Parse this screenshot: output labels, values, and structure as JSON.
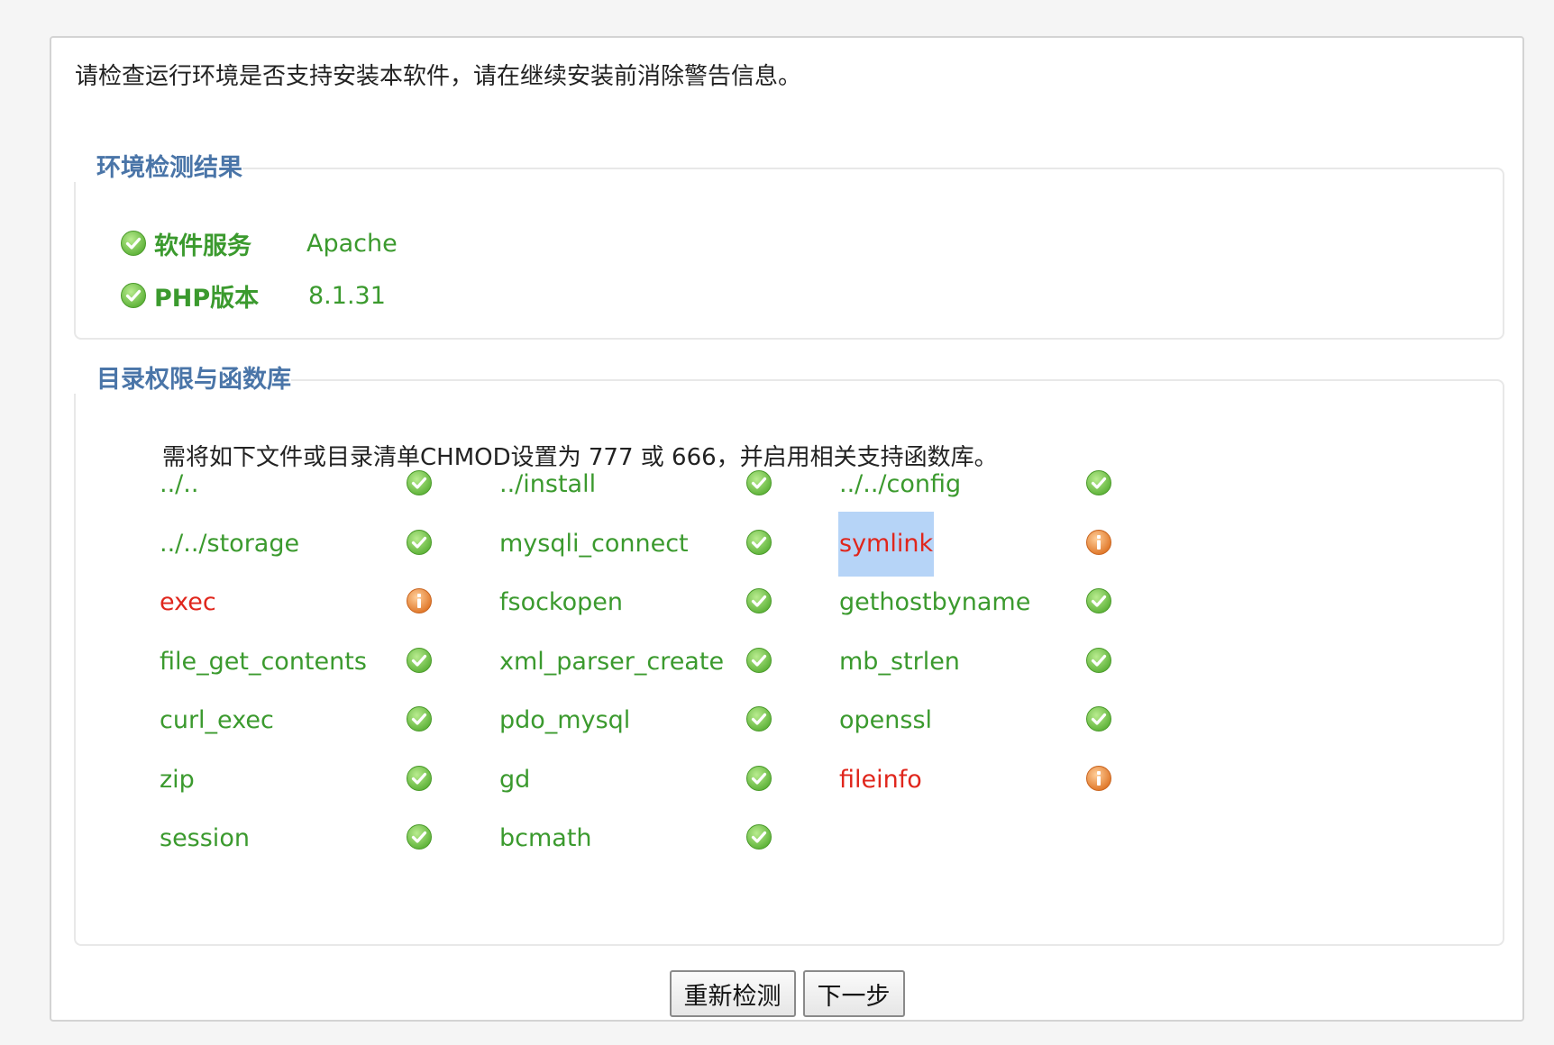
{
  "intro": "请检查运行环境是否支持安装本软件，请在继续安装前消除警告信息。",
  "env": {
    "legend": "环境检测结果",
    "rows": [
      {
        "label": "软件服务",
        "value": "Apache",
        "status": "ok"
      },
      {
        "label": "PHP版本",
        "value": "8.1.31",
        "status": "ok"
      }
    ]
  },
  "dir": {
    "legend": "目录权限与函数库",
    "note": "需将如下文件或目录清单CHMOD设置为 777 或 666，并启用相关支持函数库。",
    "items": [
      {
        "name": "../..",
        "status": "ok"
      },
      {
        "name": "../install",
        "status": "ok"
      },
      {
        "name": "../../config",
        "status": "ok"
      },
      {
        "name": "../../storage",
        "status": "ok"
      },
      {
        "name": "mysqli_connect",
        "status": "ok"
      },
      {
        "name": "symlink",
        "status": "warn",
        "highlighted": true
      },
      {
        "name": "exec",
        "status": "warn"
      },
      {
        "name": "fsockopen",
        "status": "ok"
      },
      {
        "name": "gethostbyname",
        "status": "ok"
      },
      {
        "name": "file_get_contents",
        "status": "ok"
      },
      {
        "name": "xml_parser_create",
        "status": "ok"
      },
      {
        "name": "mb_strlen",
        "status": "ok"
      },
      {
        "name": "curl_exec",
        "status": "ok"
      },
      {
        "name": "pdo_mysql",
        "status": "ok"
      },
      {
        "name": "openssl",
        "status": "ok"
      },
      {
        "name": "zip",
        "status": "ok"
      },
      {
        "name": "gd",
        "status": "ok"
      },
      {
        "name": "fileinfo",
        "status": "warn"
      },
      {
        "name": "session",
        "status": "ok"
      },
      {
        "name": "bcmath",
        "status": "ok"
      }
    ]
  },
  "buttons": {
    "recheck": "重新检测",
    "next": "下一步"
  },
  "icons": {
    "ok": "check-circle-icon",
    "warn": "info-warning-icon"
  },
  "colors": {
    "ok": "#3b9a2e",
    "warn": "#e0261c",
    "legend": "#4a75a8"
  }
}
